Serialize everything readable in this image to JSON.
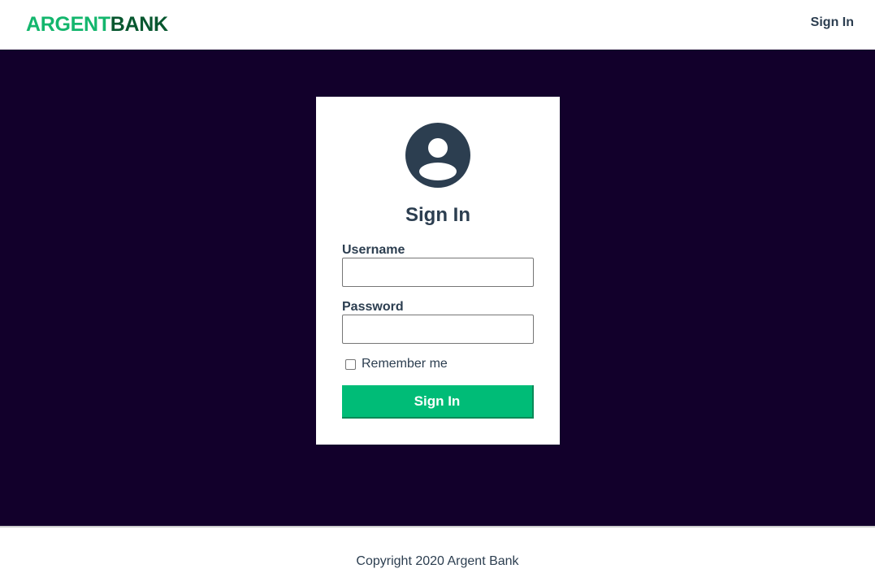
{
  "header": {
    "logo_part1": "ARGENT",
    "logo_part2": "BANK",
    "signin_link": "Sign In"
  },
  "form": {
    "title": "Sign In",
    "avatar_icon": "user-circle-icon",
    "username_label": "Username",
    "username_value": "",
    "password_label": "Password",
    "password_value": "",
    "remember_label": "Remember me",
    "remember_checked": false,
    "submit_label": "Sign In"
  },
  "footer": {
    "copyright": "Copyright 2020 Argent Bank"
  },
  "colors": {
    "brand_green": "#00bc77",
    "logo_light_green": "#13b66d",
    "logo_dark_green": "#07572f",
    "main_background": "#12002b",
    "text_dark": "#2c3e50"
  }
}
